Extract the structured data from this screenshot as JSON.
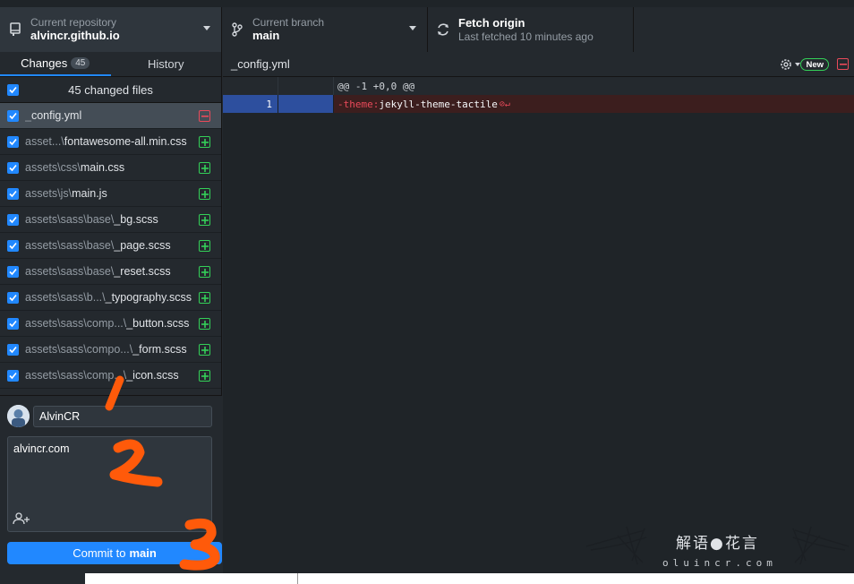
{
  "toolbar": {
    "repo_label": "Current repository",
    "repo_value": "alvincr.github.io",
    "branch_label": "Current branch",
    "branch_value": "main",
    "fetch_label": "Fetch origin",
    "fetch_sub": "Last fetched 10 minutes ago"
  },
  "sidebar": {
    "tabs": [
      {
        "label": "Changes",
        "badge": "45",
        "active": true
      },
      {
        "label": "History",
        "active": false
      }
    ],
    "changed_files_label": "45 changed files",
    "files": [
      {
        "dir": "_",
        "name": "config.yml",
        "status": "deleted",
        "selected": true
      },
      {
        "dir": "asset...\\",
        "name": "fontawesome-all.min.css",
        "status": "added"
      },
      {
        "dir": "assets\\css\\",
        "name": "main.css",
        "status": "added"
      },
      {
        "dir": "assets\\js\\",
        "name": "main.js",
        "status": "added"
      },
      {
        "dir": "assets\\sass\\base\\",
        "name": "_bg.scss",
        "status": "added"
      },
      {
        "dir": "assets\\sass\\base\\",
        "name": "_page.scss",
        "status": "added"
      },
      {
        "dir": "assets\\sass\\base\\",
        "name": "_reset.scss",
        "status": "added"
      },
      {
        "dir": "assets\\sass\\b...\\",
        "name": "_typography.scss",
        "status": "added"
      },
      {
        "dir": "assets\\sass\\comp...\\",
        "name": "_button.scss",
        "status": "added"
      },
      {
        "dir": "assets\\sass\\compo...\\",
        "name": "_form.scss",
        "status": "added"
      },
      {
        "dir": "assets\\sass\\comp...\\",
        "name": "_icon.scss",
        "status": "added"
      }
    ]
  },
  "commit": {
    "summary_value": "AlvinCR",
    "description_value": "alvincr.com",
    "button_prefix": "Commit to",
    "button_branch": "main"
  },
  "diff": {
    "filename": "_config.yml",
    "new_badge": "New",
    "hunk_header": "@@ -1 +0,0 @@",
    "line_number": "1",
    "line_key": "-theme:",
    "line_value": " jekyll-theme-tactile"
  },
  "colors": {
    "accent": "#2188ff",
    "added": "#34d058",
    "deleted": "#ea4a5a"
  },
  "watermark": {
    "text": "解语●花言",
    "sub": "oluincr.com"
  }
}
